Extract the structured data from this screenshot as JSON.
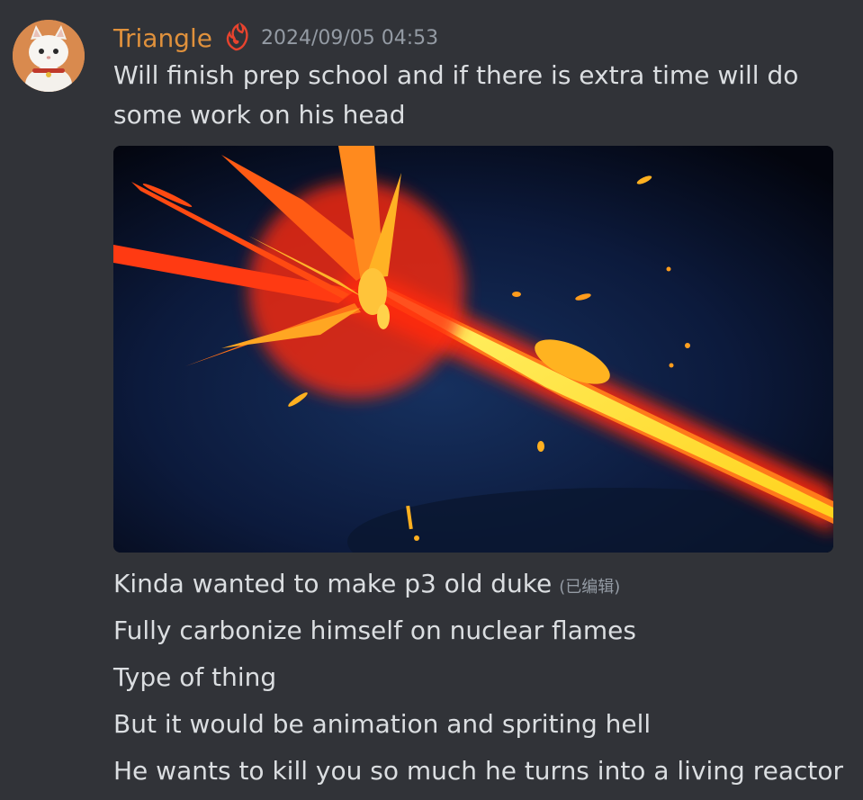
{
  "message": {
    "author": "Triangle",
    "timestamp": "2024/09/05 04:53",
    "role_icon": "flame-clover-icon",
    "avatar": "cat-avatar",
    "colors": {
      "username": "#e0913c",
      "background": "#313338",
      "text": "#dbdee1",
      "muted": "#949ba4"
    },
    "first_line": "Will finish prep school and if there is extra time will do some work on his head",
    "attachment": "flame-explosion-image",
    "lines": [
      "Kinda wanted to make p3 old duke",
      "Fully carbonize himself on nuclear flames",
      "Type of thing",
      "But it would be animation and spriting hell",
      "He wants to kill you so much he turns into a living reactor"
    ],
    "edited_label": "(已编辑)"
  }
}
